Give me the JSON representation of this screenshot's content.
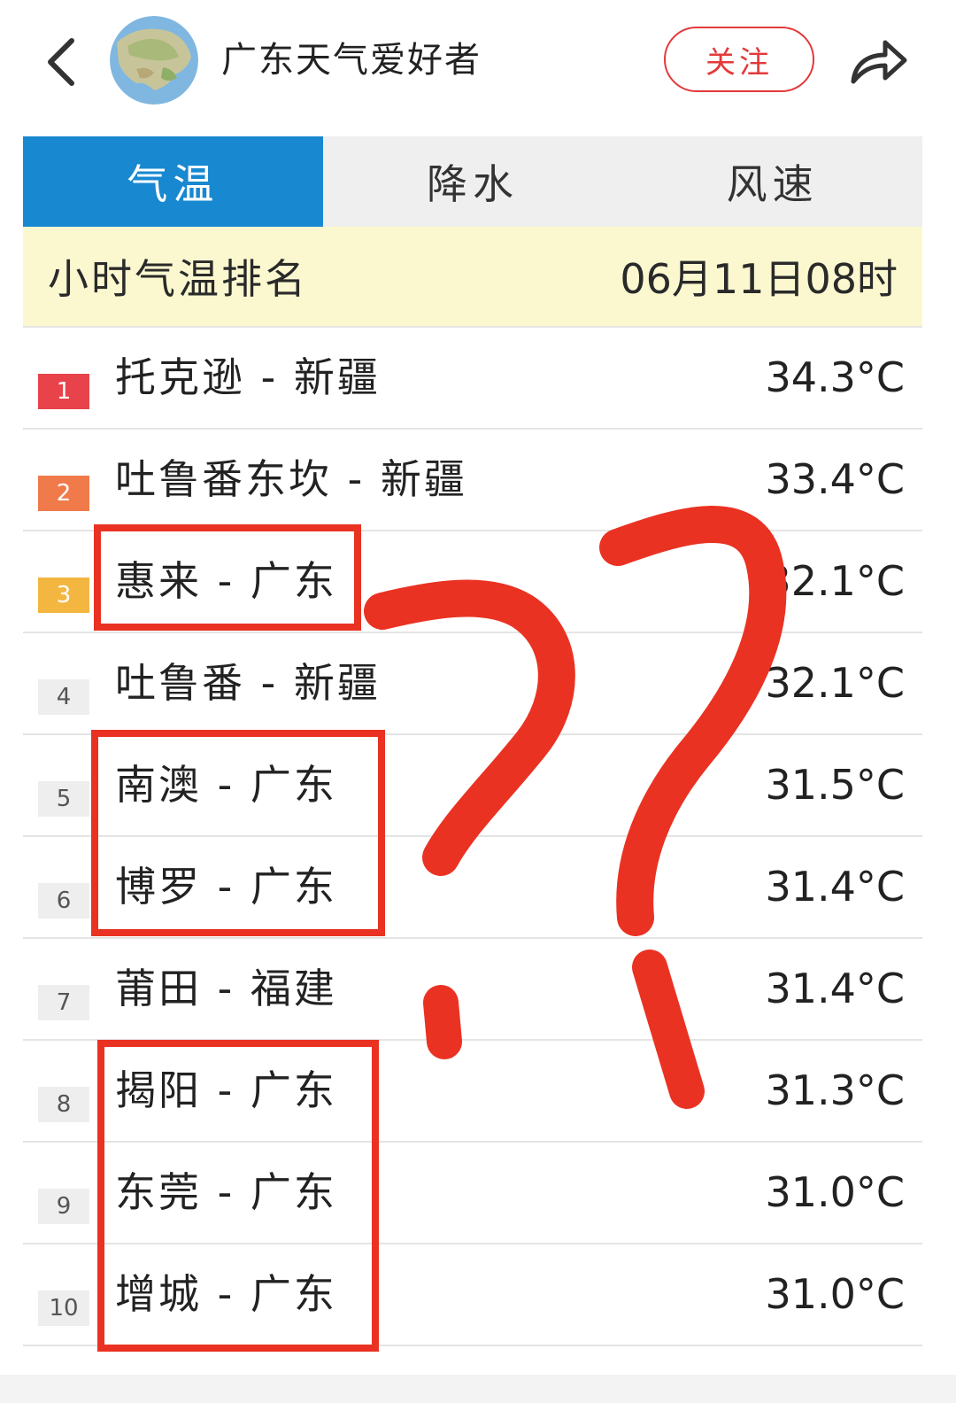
{
  "header": {
    "account_name": "广东天气爱好者",
    "follow_label": "关注"
  },
  "tabs": [
    {
      "label": "气温",
      "active": true
    },
    {
      "label": "降水",
      "active": false
    },
    {
      "label": "风速",
      "active": false
    }
  ],
  "ranking": {
    "title": "小时气温排名",
    "time": "06月11日08时"
  },
  "rows": [
    {
      "rank": "1",
      "place": "托克逊 - 新疆",
      "temp": "34.3°C",
      "badge_color": "#e8434b"
    },
    {
      "rank": "2",
      "place": "吐鲁番东坎 - 新疆",
      "temp": "33.4°C",
      "badge_color": "#f07a4a"
    },
    {
      "rank": "3",
      "place": "惠来 - 广东",
      "temp": "32.1°C",
      "badge_color": "#f3b640"
    },
    {
      "rank": "4",
      "place": "吐鲁番 - 新疆",
      "temp": "32.1°C",
      "badge_color": ""
    },
    {
      "rank": "5",
      "place": "南澳 - 广东",
      "temp": "31.5°C",
      "badge_color": ""
    },
    {
      "rank": "6",
      "place": "博罗 - 广东",
      "temp": "31.4°C",
      "badge_color": ""
    },
    {
      "rank": "7",
      "place": "莆田 - 福建",
      "temp": "31.4°C",
      "badge_color": ""
    },
    {
      "rank": "8",
      "place": "揭阳 - 广东",
      "temp": "31.3°C",
      "badge_color": ""
    },
    {
      "rank": "9",
      "place": "东莞 - 广东",
      "temp": "31.0°C",
      "badge_color": ""
    },
    {
      "rank": "10",
      "place": "增城 - 广东",
      "temp": "31.0°C",
      "badge_color": ""
    }
  ],
  "colors": {
    "accent_tab": "#1888d0",
    "follow_red": "#e33a3a",
    "annotation_red": "#ea3222",
    "header_bg": "#fbf8d0"
  },
  "icons": [
    "back-chevron-icon",
    "avatar-map-icon",
    "share-arrow-icon"
  ]
}
